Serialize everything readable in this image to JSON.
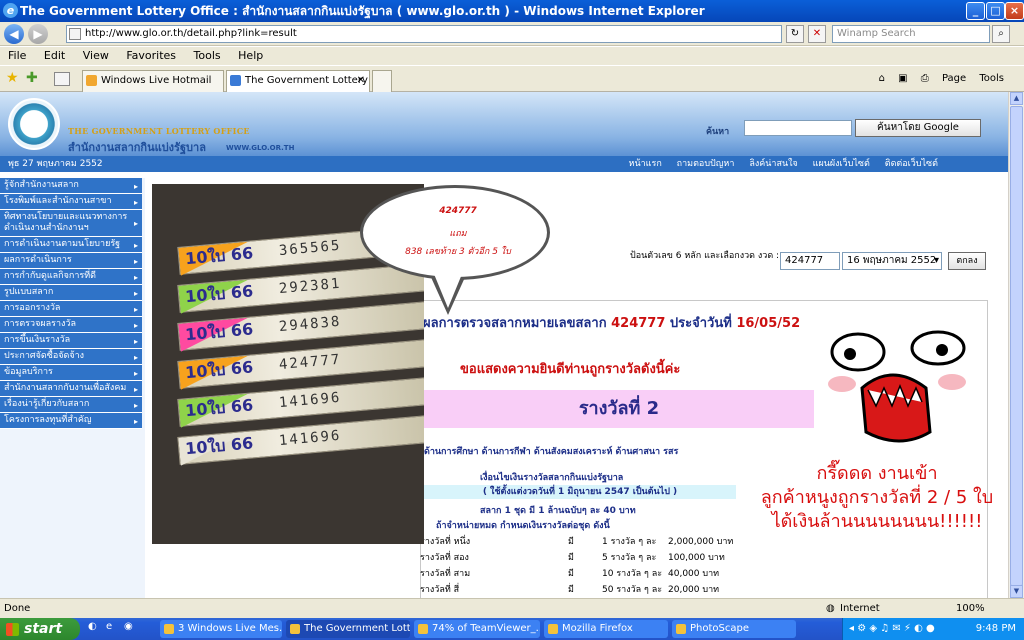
{
  "window": {
    "title": "The Government Lottery Office : สำนักงานสลากกินแบ่งรัฐบาล ( www.glo.or.th ) - Windows Internet Explorer"
  },
  "address": {
    "url": "http://www.glo.or.th/detail.php?link=result",
    "search_placeholder": "Winamp Search"
  },
  "menu": [
    "File",
    "Edit",
    "View",
    "Favorites",
    "Tools",
    "Help"
  ],
  "tabs": [
    {
      "label": "Windows Live Hotmail"
    },
    {
      "label": "The Government Lottery ..."
    }
  ],
  "cmdbar": {
    "page": "Page",
    "tools": "Tools"
  },
  "site": {
    "logo_en": "THE GOVERNMENT LOTTERY OFFICE",
    "logo_th": "สำนักงานสลากกินแบ่งรัฐบาล",
    "logo_url": "WWW.GLO.OR.TH",
    "search_label": "ค้นหา",
    "google_button": "ค้นหาโดย Google",
    "date": "พุธ 27 พฤษภาคม 2552",
    "toplinks": [
      "หน้าแรก",
      "ถามตอบปัญหา",
      "ลิงค์น่าสนใจ",
      "แผนผังเว็บไซต์",
      "ติดต่อเว็บไซต์"
    ]
  },
  "sidebar": [
    "รู้จักสำนักงานสลาก",
    "โรงพิมพ์และสำนักงานสาขา",
    "ทิศทางนโยบายและแนวทางการดำเนินงานสำนักงานฯ",
    "การดำเนินงานตามนโยบายรัฐ",
    "ผลการดำเนินการ",
    "การกำกับดูแลกิจการที่ดี",
    "รูปแบบสลาก",
    "การออกรางวัล",
    "การตรวจผลรางวัล",
    "การขึ้นเงินรางวัล",
    "ประกาศจัดซื้อจัดจ้าง",
    "ข้อมูลบริการ",
    "สำนักงานสลากกับงานเพื่อสังคม",
    "เรื่องน่ารู้เกี่ยวกับสลาก",
    "โครงการลงทุนที่สำคัญ"
  ],
  "photo": {
    "tickets": [
      "365565",
      "292381",
      "294838",
      "424777",
      "141696",
      "141696"
    ],
    "ticket_prefix": "10ใบ 66"
  },
  "bubble": {
    "line1": "424777",
    "line2": "แถม",
    "line3": "838 เลขท้าย 3 ตัวอีก 5 ใบ"
  },
  "form": {
    "label": "ป้อนตัวเลข 6 หลัก และเลือกงวด งวด :",
    "number": "424777",
    "date": "16 พฤษภาคม 2552",
    "button": "ตกลง"
  },
  "result": {
    "title_prefix": "ผลการตรวจสลากหมายเลขสลาก",
    "number": "424777",
    "title_mid": "ประจำวันที่",
    "date": "16/05/52",
    "congrats": "ขอแสดงความยินดีท่านถูกรางวัลดังนี้ค่ะ",
    "prize": "รางวัลที่ 2",
    "fund_line": "ด้านการศึกษา ด้านการกีฬา ด้านสังคมสงเคราะห์ ด้านศาสนา รสร",
    "cond_title": "เงื่อนไขเงินรางวัลสลากกินแบ่งรัฐบาล",
    "cond_date": "( ใช้ตั้งแต่งวดวันที่ 1 มิถุนายน 2547 เป็นต้นไป )",
    "cond_price": "สลาก 1 ชุด มี 1 ล้านฉบับๆ ละ 40 บาท",
    "cond_sale": "ถ้าจำหน่ายหมด กำหนดเงินรางวัลต่อชุด ดังนี้",
    "prizes": [
      {
        "name": "รางวัลที่ หนึ่ง",
        "count": "มี",
        "units": "1 รางวัล ๆ ละ",
        "amount": "2,000,000 บาท"
      },
      {
        "name": "รางวัลที่ สอง",
        "count": "มี",
        "units": "5 รางวัล ๆ ละ",
        "amount": "100,000 บาท"
      },
      {
        "name": "รางวัลที่ สาม",
        "count": "มี",
        "units": "10 รางวัล ๆ ละ",
        "amount": "40,000 บาท"
      },
      {
        "name": "รางวัลที่ สี่",
        "count": "มี",
        "units": "50 รางวัล ๆ ละ",
        "amount": "20,000 บาท"
      }
    ]
  },
  "caption": {
    "line1": "กรี๊ดดด งานเข้า",
    "line2": "ลูกค้าหนูงถูกรางวัลที่ 2 / 5 ใบ",
    "line3": "ได้เงินล้านนนนนนนน!!!!!!"
  },
  "status": {
    "left": "Done",
    "zone": "Internet",
    "zoom": "100%"
  },
  "taskbar": {
    "start": "start",
    "tasks": [
      "3 Windows Live Mes...",
      "The Government Lott...",
      "74% of TeamViewer_...",
      "Mozilla Firefox",
      "PhotoScape"
    ],
    "clock": "9:48 PM"
  }
}
